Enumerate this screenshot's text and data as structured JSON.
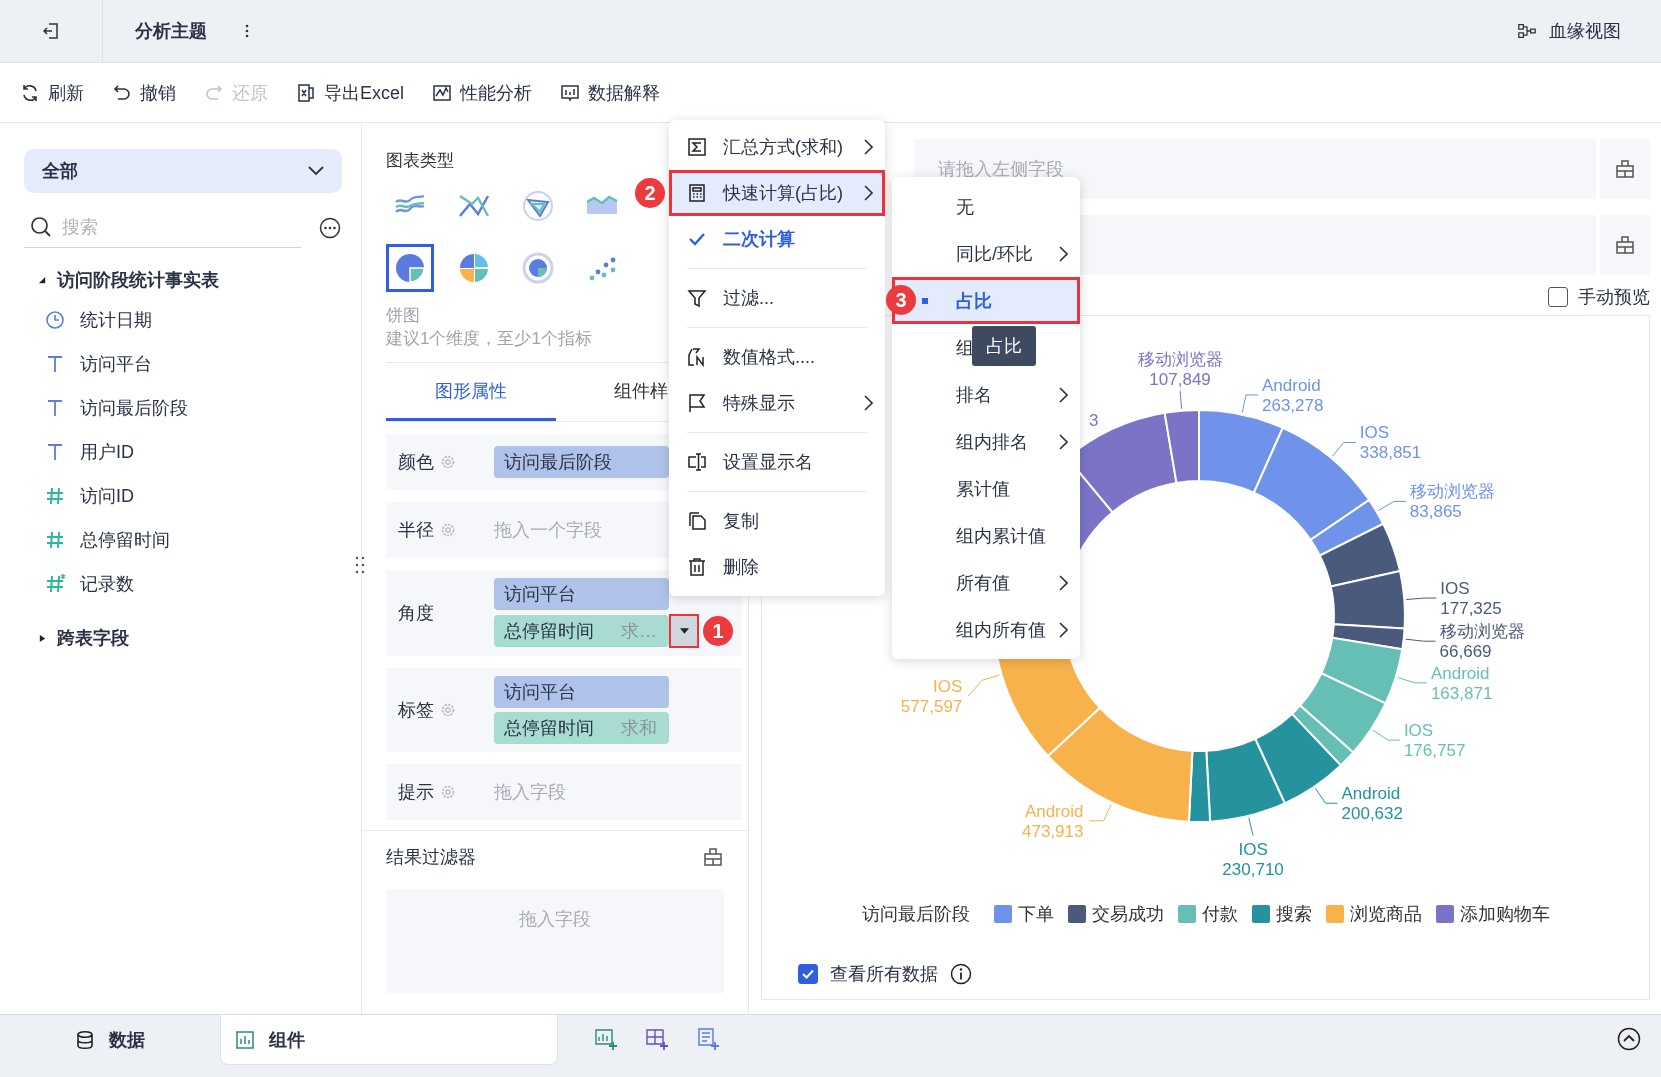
{
  "topbar": {
    "title": "分析主题",
    "lineage_link": "血缘视图"
  },
  "toolbar": [
    {
      "label": "刷新",
      "disabled": false
    },
    {
      "label": "撤销",
      "disabled": false
    },
    {
      "label": "还原",
      "disabled": true
    },
    {
      "label": "导出Excel",
      "disabled": false
    },
    {
      "label": "性能分析",
      "disabled": false
    },
    {
      "label": "数据解释",
      "disabled": false
    }
  ],
  "left_panel": {
    "scope_select": "全部",
    "search": {
      "placeholder": "搜索"
    },
    "tree": [
      {
        "label": "访问阶段统计事实表",
        "expanded": true,
        "children": [
          {
            "label": "统计日期",
            "kind": "date"
          },
          {
            "label": "访问平台",
            "kind": "text"
          },
          {
            "label": "访问最后阶段",
            "kind": "text"
          },
          {
            "label": "用户ID",
            "kind": "text"
          },
          {
            "label": "访问ID",
            "kind": "number"
          },
          {
            "label": "总停留时间",
            "kind": "number"
          },
          {
            "label": "记录数",
            "kind": "calculated"
          }
        ]
      },
      {
        "label": "跨表字段",
        "expanded": false
      }
    ]
  },
  "chart_types": {
    "title": "图表类型",
    "options": [
      {
        "selected": false
      },
      {
        "selected": false
      },
      {
        "selected": false
      },
      {
        "selected": false
      },
      {
        "selected": true
      },
      {
        "selected": false
      },
      {
        "selected": false
      },
      {
        "selected": false
      }
    ],
    "name": "饼图",
    "hint": "建议1个维度，至少1个指标"
  },
  "property_tabs": [
    {
      "label": "图形属性",
      "selected": true
    },
    {
      "label": "组件样",
      "selected": false
    }
  ],
  "properties": [
    {
      "label": "颜色",
      "has_settings": true,
      "fields": [
        {
          "name": "访问最后阶段",
          "kind": "dimension"
        }
      ]
    },
    {
      "label": "半径",
      "has_settings": true,
      "placeholder": "拖入一个字段"
    },
    {
      "label": "角度",
      "has_settings": false,
      "fields": [
        {
          "name": "访问平台",
          "kind": "dimension"
        },
        {
          "name": "总停留时间",
          "aggregation": "求…",
          "kind": "measure",
          "badge": "1"
        }
      ]
    },
    {
      "label": "标签",
      "has_settings": true,
      "fields": [
        {
          "name": "访问平台",
          "kind": "dimension"
        },
        {
          "name": "总停留时间",
          "aggregation": "求和",
          "kind": "measure"
        }
      ]
    },
    {
      "label": "提示",
      "has_settings": true,
      "placeholder": "拖入字段"
    }
  ],
  "result_filter": {
    "title": "结果过滤器",
    "placeholder": "拖入字段"
  },
  "drop_rows": [
    {
      "placeholder": "请拖入左侧字段"
    },
    {}
  ],
  "manual_preview": {
    "label": "手动预览",
    "checked": false
  },
  "chart": {
    "legend_title": "访问最后阶段",
    "legend": [
      {
        "name": "下单",
        "color": "#6f93ea"
      },
      {
        "name": "交易成功",
        "color": "#4a5a7c"
      },
      {
        "name": "付款",
        "color": "#66bfb5"
      },
      {
        "name": "搜索",
        "color": "#24939e"
      },
      {
        "name": "浏览商品",
        "color": "#f7b24c"
      },
      {
        "name": "添加购物车",
        "color": "#7b73c6"
      }
    ],
    "slice_labels": [
      {
        "name": "Android",
        "value": "263,278"
      },
      {
        "name": "IOS",
        "value": "338,851"
      },
      {
        "name": "移动浏览器",
        "value": "83,865"
      },
      {
        "name": "IOS",
        "value": "177,325"
      },
      {
        "name": "移动浏览器",
        "value": "66,669"
      },
      {
        "name": "Android",
        "value": "163,871"
      },
      {
        "name": "IOS",
        "value": "176,757"
      },
      {
        "name": "Android",
        "value": "200,632"
      },
      {
        "name": "IOS",
        "value": "230,710"
      },
      {
        "name": "Android",
        "value": "473,913"
      },
      {
        "name": "IOS",
        "value": "577,597"
      },
      {
        "name": "移动浏览器",
        "value": "107,849"
      }
    ],
    "label_fragment": "3"
  },
  "view_all": {
    "label": "查看所有数据",
    "checked": true
  },
  "bottom_tabs": [
    {
      "label": "数据",
      "selected": false
    },
    {
      "label": "组件",
      "selected": true
    }
  ],
  "context_menu": {
    "groups": [
      {
        "items": [
          {
            "label": "汇总方式(求和)",
            "submenu": true,
            "selected": false,
            "checked": false
          },
          {
            "label": "快速计算(占比)",
            "submenu": true,
            "selected": true,
            "checked": false,
            "badge": "2"
          },
          {
            "label": "二次计算",
            "submenu": false,
            "selected": false,
            "checked": true
          }
        ]
      },
      {
        "items": [
          {
            "label": "过滤...",
            "submenu": false,
            "selected": false,
            "checked": false
          }
        ]
      },
      {
        "items": [
          {
            "label": "数值格式....",
            "submenu": false,
            "selected": false,
            "checked": false
          },
          {
            "label": "特殊显示",
            "submenu": true,
            "selected": false,
            "checked": false
          }
        ]
      },
      {
        "items": [
          {
            "label": "设置显示名",
            "submenu": false,
            "selected": false,
            "checked": false
          }
        ]
      },
      {
        "items": [
          {
            "label": "复制",
            "submenu": false,
            "selected": false,
            "checked": false
          },
          {
            "label": "删除",
            "submenu": false,
            "selected": false,
            "checked": false
          }
        ]
      }
    ]
  },
  "sub_menu": {
    "items": [
      {
        "label": "无",
        "submenu": false,
        "selected": false
      },
      {
        "label": "同比/环比",
        "submenu": true,
        "selected": false
      },
      {
        "label": "占比",
        "submenu": false,
        "selected": true,
        "badge": "3"
      },
      {
        "label": "组",
        "submenu": false,
        "selected": false,
        "tooltip": "占比"
      },
      {
        "label": "排名",
        "submenu": true,
        "selected": false
      },
      {
        "label": "组内排名",
        "submenu": true,
        "selected": false
      },
      {
        "label": "累计值",
        "submenu": false,
        "selected": false
      },
      {
        "label": "组内累计值",
        "submenu": false,
        "selected": false
      },
      {
        "label": "所有值",
        "submenu": true,
        "selected": false
      },
      {
        "label": "组内所有值",
        "submenu": true,
        "selected": false
      }
    ]
  }
}
